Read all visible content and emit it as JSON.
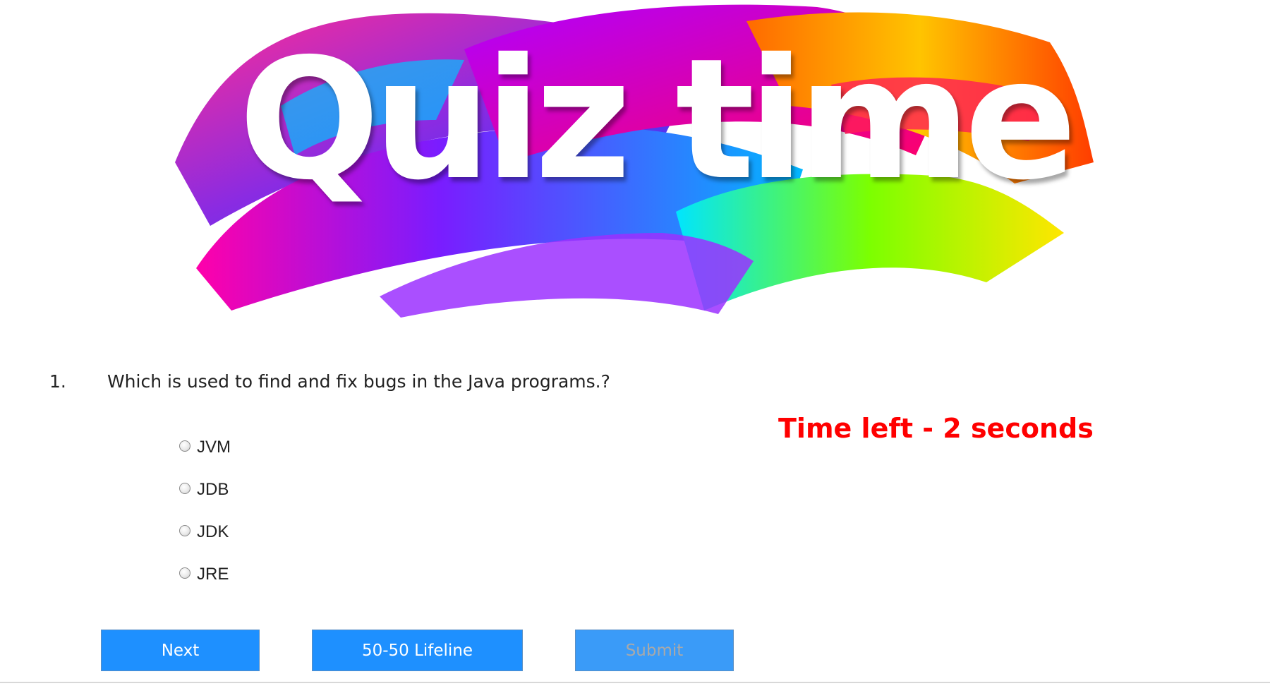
{
  "banner": {
    "title": "Quiz time"
  },
  "question": {
    "number": "1.",
    "text": "Which is used to find and fix bugs in the Java programs.?"
  },
  "options": [
    {
      "label": "JVM",
      "selected": false
    },
    {
      "label": "JDB",
      "selected": false
    },
    {
      "label": "JDK",
      "selected": false
    },
    {
      "label": "JRE",
      "selected": false
    }
  ],
  "timer": {
    "text": "Time left - 2 seconds",
    "color": "#ff0000"
  },
  "buttons": {
    "next": "Next",
    "lifeline": "50-50 Lifeline",
    "submit": "Submit"
  },
  "colors": {
    "button_bg": "#1e90ff",
    "button_text": "#ffffff",
    "submit_text_disabled": "#a9a9a9"
  }
}
